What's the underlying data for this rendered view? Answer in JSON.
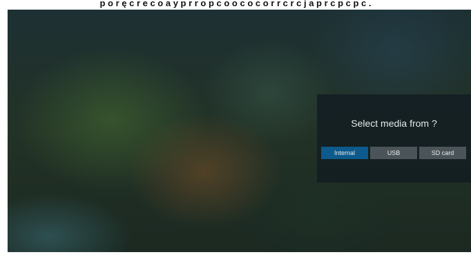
{
  "top_text": "p o r ę c r e c o a y p r r o p c o o c o c o r r c r c j a p r c p c p c .",
  "dialog": {
    "title": "Select media from ?",
    "buttons": [
      {
        "label": "Internal",
        "selected": true
      },
      {
        "label": "USB",
        "selected": false
      },
      {
        "label": "SD card",
        "selected": false
      }
    ]
  },
  "colors": {
    "selected_button": "#0d5a8c",
    "button": "#4b5559",
    "dialog_background": "#121e22"
  }
}
